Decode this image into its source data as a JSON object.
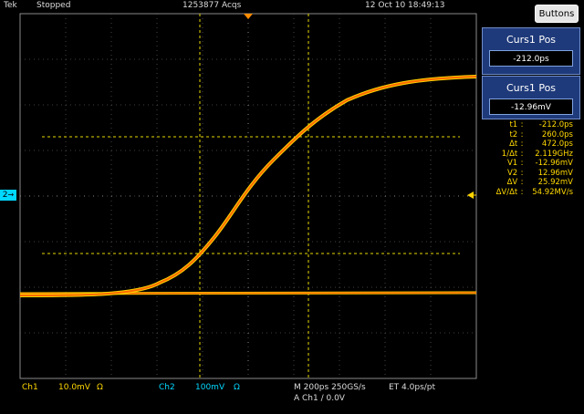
{
  "header": {
    "brand": "Tek",
    "status": "Stopped",
    "acqs": "1253877 Acqs",
    "datetime": "12 Oct 10 18:49:13",
    "buttons_label": "Buttons"
  },
  "panels": [
    {
      "title": "Curs1 Pos",
      "value": "-212.0ps"
    },
    {
      "title": "Curs1 Pos",
      "value": "-12.96mV"
    }
  ],
  "readout": [
    {
      "k": "t1",
      "v": "-212.0ps"
    },
    {
      "k": "t2",
      "v": "260.0ps"
    },
    {
      "k": "Δt",
      "v": "472.0ps"
    },
    {
      "k": "1/Δt",
      "v": "2.119GHz"
    },
    {
      "k": "V1",
      "v": "-12.96mV"
    },
    {
      "k": "V2",
      "v": "12.96mV"
    },
    {
      "k": "ΔV",
      "v": "25.92mV"
    },
    {
      "k": "ΔV/Δt",
      "v": "54.92MV/s"
    }
  ],
  "channel_marker": "2",
  "bottom": {
    "ch1_label": "Ch1",
    "ch1_scale": "10.0mV",
    "ch1_ohm": "Ω",
    "ch2_label": "Ch2",
    "ch2_scale": "100mV",
    "ch2_ohm": "Ω",
    "timebase": "M 200ps 250GS/s",
    "et": "ET 4.0ps/pt",
    "trigger": "A  Ch1  ∕  0.0V"
  },
  "colors": {
    "trace_primary": "#ff6a00",
    "trace_secondary": "#ffd400",
    "cursor": "#e6d800",
    "grid": "#7a7a7a",
    "channel2": "#00d8ff",
    "panel_bg": "#1f3a7a"
  }
}
